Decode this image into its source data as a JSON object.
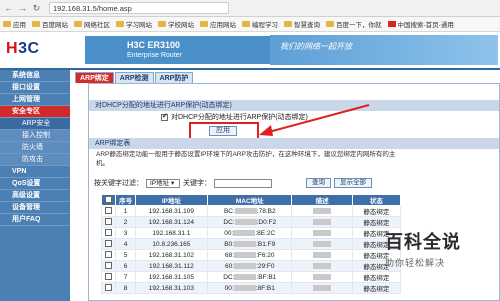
{
  "browser": {
    "url": "192.168.31.5/home.asp",
    "bookmarks": [
      {
        "label": "应用",
        "icon": "apps-icon"
      },
      {
        "label": "百度网站",
        "icon": "folder-icon"
      },
      {
        "label": "网络社区",
        "icon": "folder-icon"
      },
      {
        "label": "学习网站",
        "icon": "folder-icon"
      },
      {
        "label": "学校网站",
        "icon": "folder-icon"
      },
      {
        "label": "应用网站",
        "icon": "folder-icon"
      },
      {
        "label": "编程学习",
        "icon": "folder-icon"
      },
      {
        "label": "智慧查询",
        "icon": "folder-icon"
      },
      {
        "label": "百度一下，你就",
        "icon": "page-icon"
      },
      {
        "label": "中国搜索-首页-通用",
        "icon": "flag-icon"
      }
    ]
  },
  "header": {
    "logo": "H3C",
    "product_name": "H3C ER3100",
    "product_sub": "Enterprise Router",
    "slogan": "我们的网络一起开放"
  },
  "sidebar": {
    "items": [
      {
        "label": "系统信息",
        "type": "top",
        "active": false
      },
      {
        "label": "接口设置",
        "type": "top",
        "active": false
      },
      {
        "label": "上网管理",
        "type": "top",
        "active": false
      },
      {
        "label": "安全专区",
        "type": "top",
        "active": true
      },
      {
        "label": "ARP安全",
        "type": "sub",
        "active": true
      },
      {
        "label": "接入控制",
        "type": "sub",
        "active": false
      },
      {
        "label": "防火墙",
        "type": "sub",
        "active": false
      },
      {
        "label": "防攻击",
        "type": "sub",
        "active": false
      },
      {
        "label": "VPN",
        "type": "top",
        "active": false
      },
      {
        "label": "QoS设置",
        "type": "top",
        "active": false
      },
      {
        "label": "高级设置",
        "type": "top",
        "active": false
      },
      {
        "label": "设备管理",
        "type": "top",
        "active": false
      },
      {
        "label": "用户FAQ",
        "type": "top",
        "active": false
      }
    ]
  },
  "tabs": [
    {
      "label": "ARP绑定",
      "active": true
    },
    {
      "label": "ARP检测",
      "active": false
    },
    {
      "label": "ARP防护",
      "active": false
    }
  ],
  "section1": {
    "title": "对DHCP分配的地址进行ARP保护(动态绑定)",
    "checkbox_label": "对DHCP分配的地址进行ARP保护(动态绑定)",
    "checked": true,
    "apply_label": "应用"
  },
  "section2": {
    "title": "ARP绑定表",
    "description": "ARP静态绑定功能一般用于静态设置IP环境下的ARP攻击防护，在这种环境下，建议您绑定内网所有的主机。",
    "filter_label": "按关键字过滤：",
    "filter_option": "IP地址",
    "keyword_label": "关键字：",
    "query_label": "查询",
    "show_all_label": "显示全部"
  },
  "table": {
    "headers": [
      "序号",
      "IP地址",
      "MAC地址",
      "描述",
      "状态"
    ],
    "rows": [
      {
        "no": "1",
        "ip": "192.168.31.109",
        "mac_a": "BC:",
        "mac_b": ":78:B2",
        "status": "静态绑定"
      },
      {
        "no": "2",
        "ip": "192.168.31.124",
        "mac_a": "DC:",
        "mac_b": ":D0:F2",
        "status": "静态绑定"
      },
      {
        "no": "3",
        "ip": "192.168.31.1",
        "mac_a": "00:",
        "mac_b": ":8E:2C",
        "status": "静态绑定"
      },
      {
        "no": "4",
        "ip": "10.8.236.165",
        "mac_a": "B0:",
        "mac_b": ":B1:F9",
        "status": "静态绑定"
      },
      {
        "no": "5",
        "ip": "192.168.31.102",
        "mac_a": "68:",
        "mac_b": ":F6:20",
        "status": "静态绑定"
      },
      {
        "no": "6",
        "ip": "192.168.31.112",
        "mac_a": "60:",
        "mac_b": ":29:F0",
        "status": "静态绑定"
      },
      {
        "no": "7",
        "ip": "192.168.31.105",
        "mac_a": "DC:",
        "mac_b": ":BF:B1",
        "status": "静态绑定"
      },
      {
        "no": "8",
        "ip": "192.168.31.103",
        "mac_a": "00:",
        "mac_b": ":8F:B1",
        "status": "静态绑定"
      }
    ]
  },
  "watermark": {
    "main": "百科全说",
    "sub": "助你轻松解决"
  }
}
